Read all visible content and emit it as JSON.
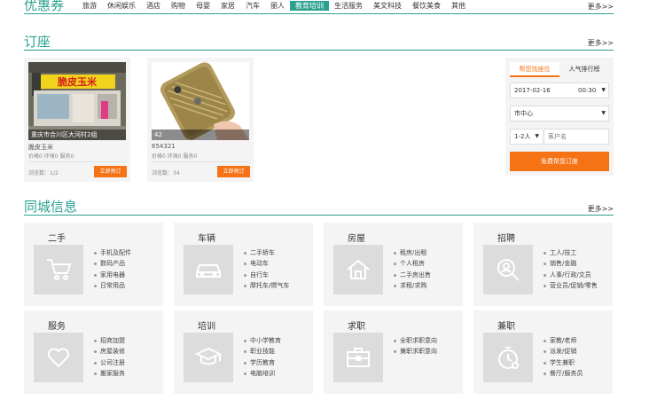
{
  "coupon": {
    "title": "优惠券",
    "categories": [
      "旅游",
      "休闲娱乐",
      "酒店",
      "购物",
      "母婴",
      "家居",
      "汽车",
      "丽人",
      "教育培训",
      "生活服务",
      "美文科技",
      "餐饮美食",
      "其他"
    ],
    "active_index": 8,
    "more": "更多>>"
  },
  "booking": {
    "title": "订座",
    "more": "更多>>",
    "cards": [
      {
        "caption": "重庆市合川区大河村2组",
        "name": "脆皮玉米",
        "stats": "价格0  环境0  服务0",
        "browse": "浏览数：1/2",
        "button": "立即预订",
        "sign_text": "脆皮玉米"
      },
      {
        "caption": "42",
        "name": "654321",
        "stats": "价格0  环境0  服务0",
        "browse": "浏览数：34",
        "button": "立即预订"
      }
    ],
    "panel": {
      "tabs": [
        "帮您找座位",
        "人气排行榜"
      ],
      "date": "2017-02-16",
      "time": "00:30",
      "area": "市中心",
      "people": "1-2人",
      "guest_placeholder": "客户名",
      "submit": "免费帮您订座"
    }
  },
  "local": {
    "title": "同城信息",
    "more": "更多>>",
    "tiles": [
      {
        "name": "二手",
        "icon": "cart-icon",
        "items": [
          "手机及配件",
          "数码产品",
          "家用电器",
          "日常用品"
        ]
      },
      {
        "name": "车辆",
        "icon": "car-icon",
        "items": [
          "二手轿车",
          "电动车",
          "自行车",
          "摩托车/燃气车"
        ]
      },
      {
        "name": "房屋",
        "icon": "house-icon",
        "items": [
          "租房/出租",
          "个人租房",
          "二手房出售",
          "求租/求购"
        ]
      },
      {
        "name": "招聘",
        "icon": "magnifier-person-icon",
        "items": [
          "工人/技工",
          "销售/金融",
          "人事/行政/文员",
          "营业员/促销/零售"
        ]
      },
      {
        "name": "服务",
        "icon": "heart-icon",
        "items": [
          "招商加盟",
          "房屋装修",
          "公司注册",
          "搬家服务"
        ]
      },
      {
        "name": "培训",
        "icon": "graduation-cap-icon",
        "items": [
          "中小学教育",
          "职业技能",
          "学历教育",
          "电脑培训"
        ]
      },
      {
        "name": "求职",
        "icon": "briefcase-icon",
        "items": [
          "全职求职意向",
          "兼职求职意向"
        ]
      },
      {
        "name": "兼职",
        "icon": "stopwatch-icon",
        "items": [
          "家教/老师",
          "派发/促销",
          "学生兼职",
          "餐厅/服务员"
        ]
      }
    ]
  },
  "colors": {
    "accent": "#2aa18f",
    "orange": "#f57215",
    "tile_bg": "#f4f4f4",
    "icon_bg": "#dcdcdc"
  }
}
